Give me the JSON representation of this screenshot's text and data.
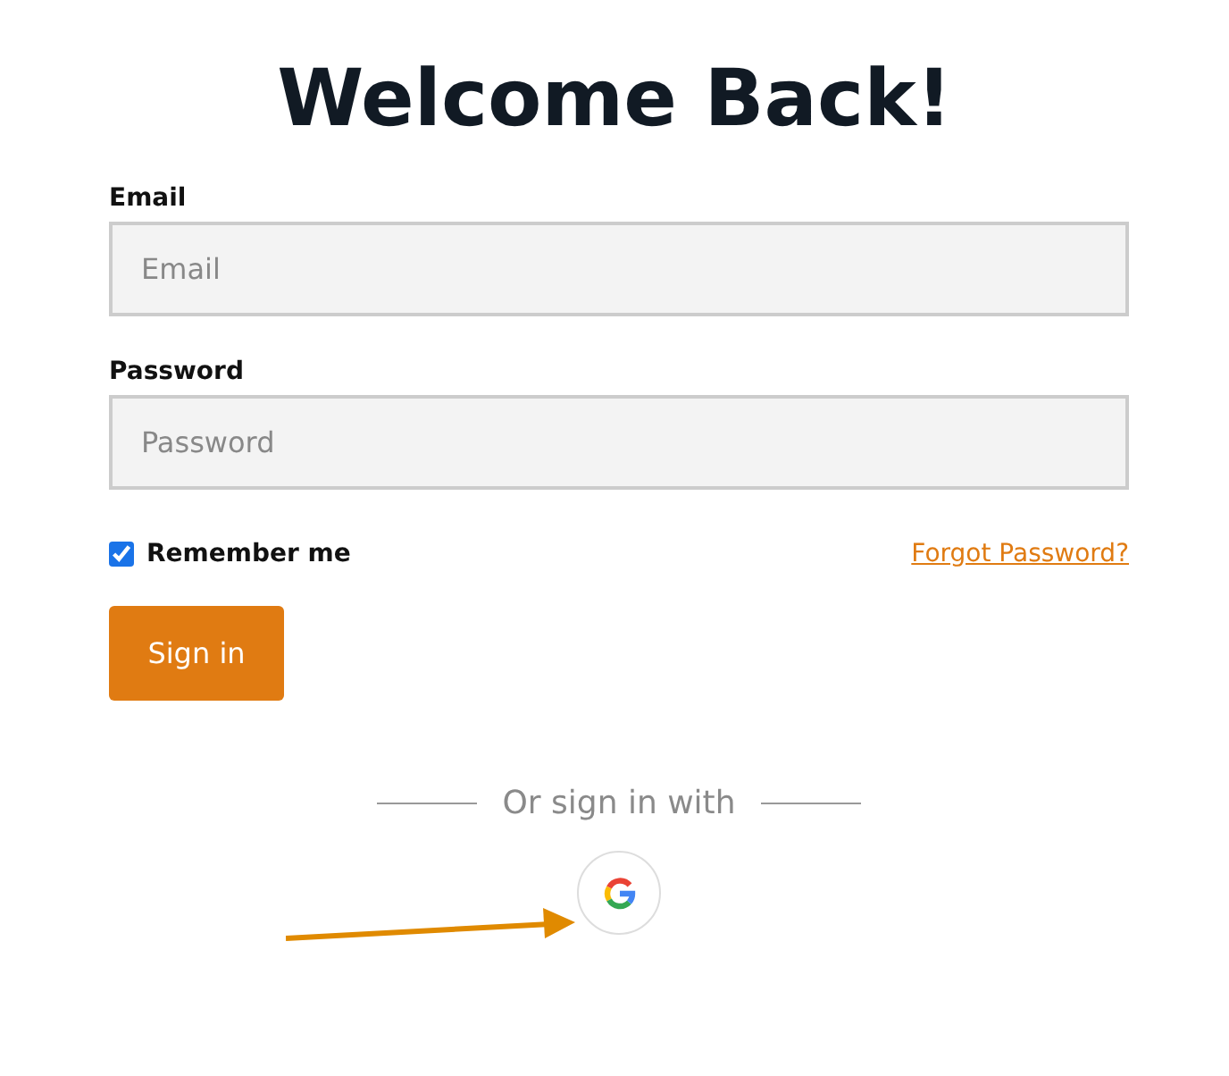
{
  "title": "Welcome Back!",
  "fields": [
    {
      "label": "Email",
      "placeholder": "Email"
    },
    {
      "label": "Password",
      "placeholder": "Password"
    }
  ],
  "remember": {
    "label": "Remember me",
    "checked": true
  },
  "forgot_link": "Forgot Password?",
  "submit_button": "Sign in",
  "divider_text": "Or sign in with"
}
